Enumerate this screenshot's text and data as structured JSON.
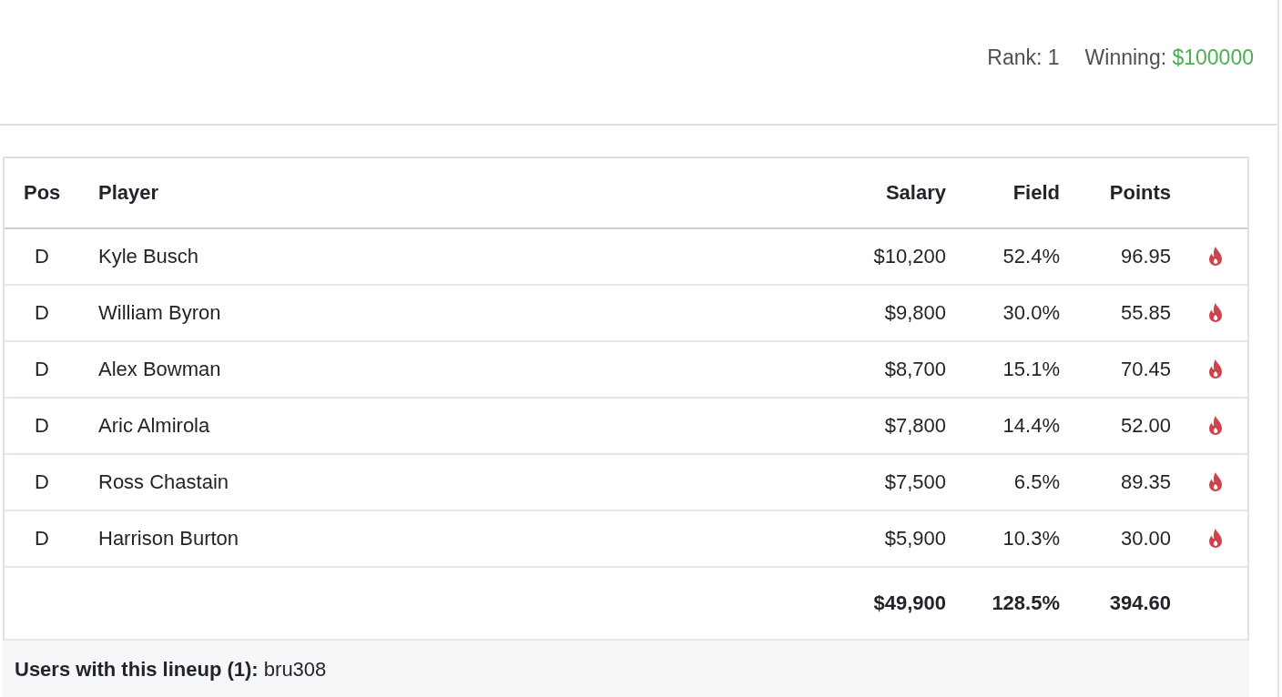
{
  "summary": {
    "rank_label": "Rank:",
    "rank": "1",
    "winning_label": "Winning:",
    "winning": "$100000"
  },
  "table": {
    "columns": [
      "Pos",
      "Player",
      "Salary",
      "Field",
      "Points"
    ],
    "rows": [
      {
        "pos": "D",
        "player": "Kyle Busch",
        "salary": "$10,200",
        "field": "52.4%",
        "points": "96.95"
      },
      {
        "pos": "D",
        "player": "William Byron",
        "salary": "$9,800",
        "field": "30.0%",
        "points": "55.85"
      },
      {
        "pos": "D",
        "player": "Alex Bowman",
        "salary": "$8,700",
        "field": "15.1%",
        "points": "70.45"
      },
      {
        "pos": "D",
        "player": "Aric Almirola",
        "salary": "$7,800",
        "field": "14.4%",
        "points": "52.00"
      },
      {
        "pos": "D",
        "player": "Ross Chastain",
        "salary": "$7,500",
        "field": "6.5%",
        "points": "89.35"
      },
      {
        "pos": "D",
        "player": "Harrison Burton",
        "salary": "$5,900",
        "field": "10.3%",
        "points": "30.00"
      }
    ],
    "totals": {
      "salary": "$49,900",
      "field": "128.5%",
      "points": "394.60"
    }
  },
  "footer": "**Users with this lineup (1):** bru308"
}
